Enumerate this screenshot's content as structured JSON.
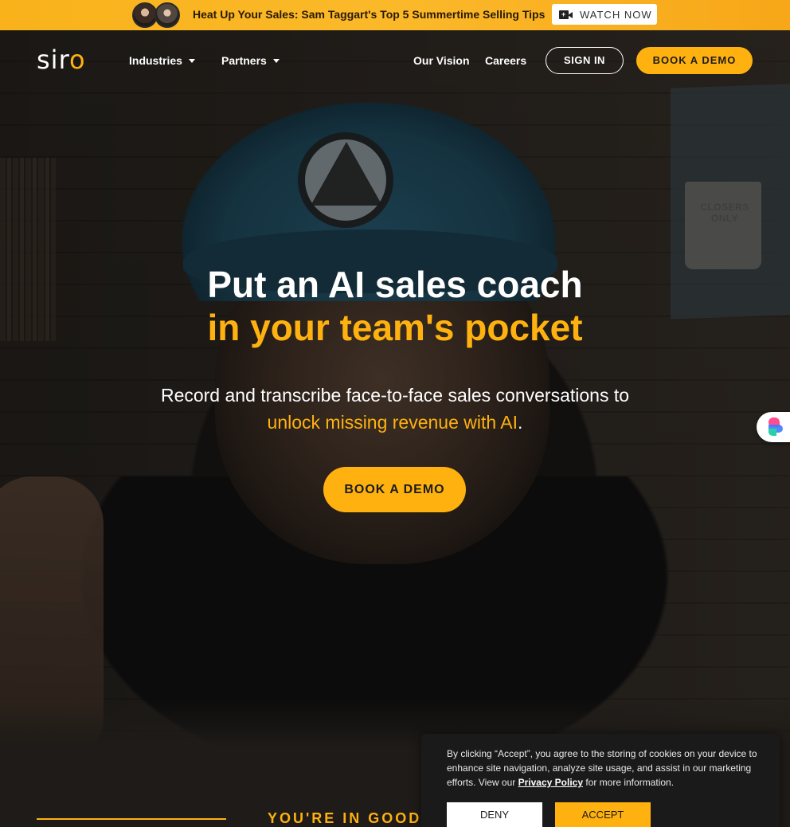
{
  "colors": {
    "accent": "#ffb20f",
    "announce_bg": "#fbb92a",
    "dark": "#1c1c1c"
  },
  "announcement": {
    "headline": "Heat Up Your Sales: Sam Taggart's Top 5 Summertime Selling Tips",
    "watch_label": "WATCH NOW",
    "watch_icon": "video-camera-icon"
  },
  "nav": {
    "logo_main": "sir",
    "logo_accent": "o",
    "items": [
      {
        "label": "Industries",
        "has_dropdown": true
      },
      {
        "label": "Partners",
        "has_dropdown": true
      },
      {
        "label": "Our Vision",
        "has_dropdown": false
      },
      {
        "label": "Careers",
        "has_dropdown": false
      }
    ],
    "sign_in": "SIGN IN",
    "book_demo": "BOOK A DEMO"
  },
  "hero": {
    "title_line1": "Put an AI sales coach",
    "title_line2": "in your team's pocket",
    "subtitle_line1": "Record and transcribe face-to-face sales conversations to",
    "subtitle_line2": "unlock missing revenue with AI",
    "subtitle_end": ".",
    "cta": "BOOK A DEMO",
    "background_mug_text": "CLOSERS ONLY"
  },
  "section": {
    "heading_partial": "YOU'RE IN GOOD"
  },
  "cookie": {
    "text_before": "By clicking “Accept”, you agree to the storing of cookies on your device to enhance site navigation, analyze site usage, and assist in our marketing efforts. View our ",
    "link": "Privacy Policy",
    "text_after": " for more information.",
    "deny": "DENY",
    "accept": "ACCEPT"
  }
}
